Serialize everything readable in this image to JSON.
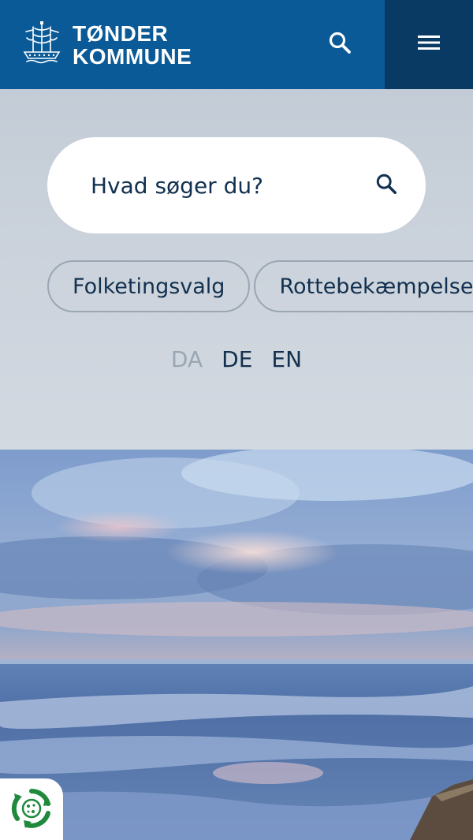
{
  "header": {
    "brand_line1": "TØNDER",
    "brand_line2": "KOMMUNE",
    "logo_icon": "ship-logo-icon",
    "search_icon": "search-icon",
    "menu_icon": "hamburger-menu-icon",
    "colors": {
      "header_bg": "#0a5a97",
      "menu_bg": "#083a63"
    }
  },
  "hero": {
    "search": {
      "placeholder": "Hvad søger du?",
      "icon": "search-icon"
    },
    "quick_links": [
      {
        "label": "Folketingsvalg"
      },
      {
        "label": "Rottebekæmpelse"
      }
    ],
    "languages": [
      {
        "label": "DA",
        "active": true
      },
      {
        "label": "DE",
        "active": false
      },
      {
        "label": "EN",
        "active": false
      }
    ]
  },
  "consent_badge": {
    "icon": "cookie-consent-icon"
  }
}
